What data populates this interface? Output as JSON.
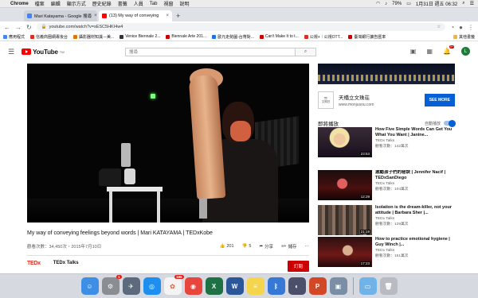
{
  "menubar": {
    "app": "Chrome",
    "items": [
      "檔案",
      "編輯",
      "顯示方式",
      "歷史紀錄",
      "書籤",
      "人員",
      "Tab",
      "視窗",
      "說明"
    ],
    "battery": "79%",
    "clock": "1月31日 週五 06:32"
  },
  "tabs": [
    {
      "title": "Mari Katayama - Google 搜尋",
      "icon": "google-icon",
      "color": "#4285f4"
    },
    {
      "title": "(13) My way of conveying",
      "icon": "youtube-icon",
      "color": "#ff0000"
    }
  ],
  "omnibox": {
    "url": "youtube.com/watch?v=sESC5HKI4w4"
  },
  "bookmarks": [
    {
      "label": "應用程式",
      "color": "#4285f4"
    },
    {
      "label": "信義商圈網專後台",
      "color": "#d93025"
    },
    {
      "label": "攝影器材知識－美...",
      "color": "#e37400"
    },
    {
      "label": "Venice Biennale 2...",
      "color": "#333"
    },
    {
      "label": "Biennale Arte 201...",
      "color": "#c00"
    },
    {
      "label": "歐元走勢圖-台幣對...",
      "color": "#1a73e8"
    },
    {
      "label": "Can't Make It to t...",
      "color": "#c00"
    },
    {
      "label": "公視+｜公視OTT...",
      "color": "#d93025"
    },
    {
      "label": "臺灣銀行擴告匯率",
      "color": "#c00"
    }
  ],
  "bookmarks_other": "其他書籤",
  "youtube": {
    "logo": "YouTube",
    "region": "TW",
    "search_placeholder": "搜尋",
    "notif_count": "9+",
    "avatar_letter": "L"
  },
  "video": {
    "title": "My way of conveying feelings beyond words | Mari KATAYAMA | TEDxKobe",
    "views": "觀看次數：34,450次・2015年7月10日",
    "likes": "201",
    "dislikes": "5",
    "share": "分享",
    "save": "儲存",
    "more": "⋯",
    "channel_brand": "TEDx",
    "channel": "TEDx Talks",
    "subscribe": "訂閱"
  },
  "ad": {
    "name": "天橋立文珠荘",
    "url": "www.monjusou.com",
    "logo_text": "文珠荘",
    "cta": "SEE MORE"
  },
  "upnext": {
    "heading": "即將播放",
    "autoplay": "自動播放"
  },
  "recommendations": [
    {
      "title": "How Five Simple Words Can Get You What You Want | Janine...",
      "channel": "TEDx Talks",
      "views": "觀看次數：142萬次",
      "duration": "23:53"
    },
    {
      "title": "激勵孩子們的秘訣 | Jennifer Nacif | TEDxSanDiego",
      "channel": "TEDx Talks",
      "views": "觀看次數：104萬次",
      "duration": "12:29"
    },
    {
      "title": "Isolation is the dream-killer, not your attitude | Barbara Sher |...",
      "channel": "TEDx Talks",
      "views": "觀看次數：129萬次",
      "duration": "21:19"
    },
    {
      "title": "How to practice emotional hygiene | Guy Winch |...",
      "channel": "TEDx Talks",
      "views": "觀看次數：151萬次",
      "duration": "17:23"
    }
  ],
  "dock": [
    {
      "name": "finder",
      "color": "#3d8fe6",
      "glyph": "☺"
    },
    {
      "name": "system-preferences",
      "color": "#8a8d92",
      "glyph": "⚙",
      "badge": "1"
    },
    {
      "name": "launchpad",
      "color": "#5b6a7d",
      "glyph": "✈"
    },
    {
      "name": "safari",
      "color": "#1d8ff0",
      "glyph": "◎"
    },
    {
      "name": "photos",
      "color": "#f4f4f4",
      "glyph": "✿",
      "badge": "195"
    },
    {
      "name": "chrome",
      "color": "#e8453c",
      "glyph": "◉"
    },
    {
      "name": "excel",
      "color": "#1e7145",
      "glyph": "X"
    },
    {
      "name": "word",
      "color": "#2b579a",
      "glyph": "W"
    },
    {
      "name": "notes",
      "color": "#f5d54b",
      "glyph": "≡"
    },
    {
      "name": "bluetooth",
      "color": "#3778d6",
      "glyph": "ᛒ"
    },
    {
      "name": "macos-installer",
      "color": "#4b4f6a",
      "glyph": "◐"
    },
    {
      "name": "powerpoint",
      "color": "#d24726",
      "glyph": "P"
    },
    {
      "name": "preview",
      "color": "#7a8fa6",
      "glyph": "▣"
    },
    {
      "name": "downloads-folder",
      "color": "#6fb3e8",
      "glyph": "▭"
    },
    {
      "name": "trash",
      "color": "#b8bcc2",
      "glyph": "🗑"
    }
  ]
}
